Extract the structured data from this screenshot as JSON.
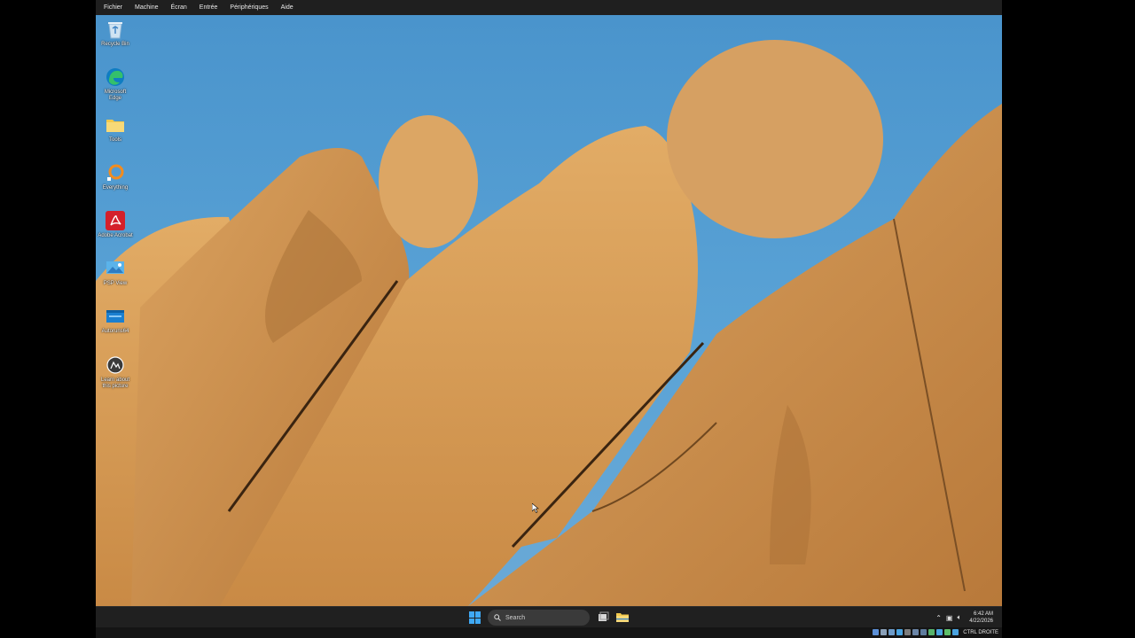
{
  "vbox_menu": {
    "items": [
      "Fichier",
      "Machine",
      "Écran",
      "Entrée",
      "Périphériques",
      "Aide"
    ]
  },
  "desktop": {
    "icons": [
      {
        "label": "Recycle Bin",
        "icon": "recycle-bin-icon"
      },
      {
        "label": "Microsoft Edge",
        "icon": "edge-icon"
      },
      {
        "label": "Tools",
        "icon": "folder-icon"
      },
      {
        "label": "Everything",
        "icon": "everything-icon"
      },
      {
        "label": "Adobe Acrobat",
        "icon": "acrobat-icon"
      },
      {
        "label": "PSP View",
        "icon": "image-viewer-icon"
      },
      {
        "label": "Autoruns64",
        "icon": "autoruns-icon"
      },
      {
        "label": "Learn about this picture",
        "icon": "learn-picture-icon"
      }
    ],
    "wallpaper": "rock-formation"
  },
  "taskbar": {
    "search_placeholder": "Search",
    "clock": {
      "time": "6:42 AM",
      "date": "4/22/2026"
    },
    "tray_icons": [
      "chevron-up-icon",
      "network-icon",
      "volume-icon"
    ]
  },
  "vbox_status": {
    "host_key": "CTRL DROITE"
  },
  "colors": {
    "sky": "#5aa3d6",
    "rock": "#d49a52",
    "taskbar": "#202020",
    "accent": "#3fa9f5"
  }
}
